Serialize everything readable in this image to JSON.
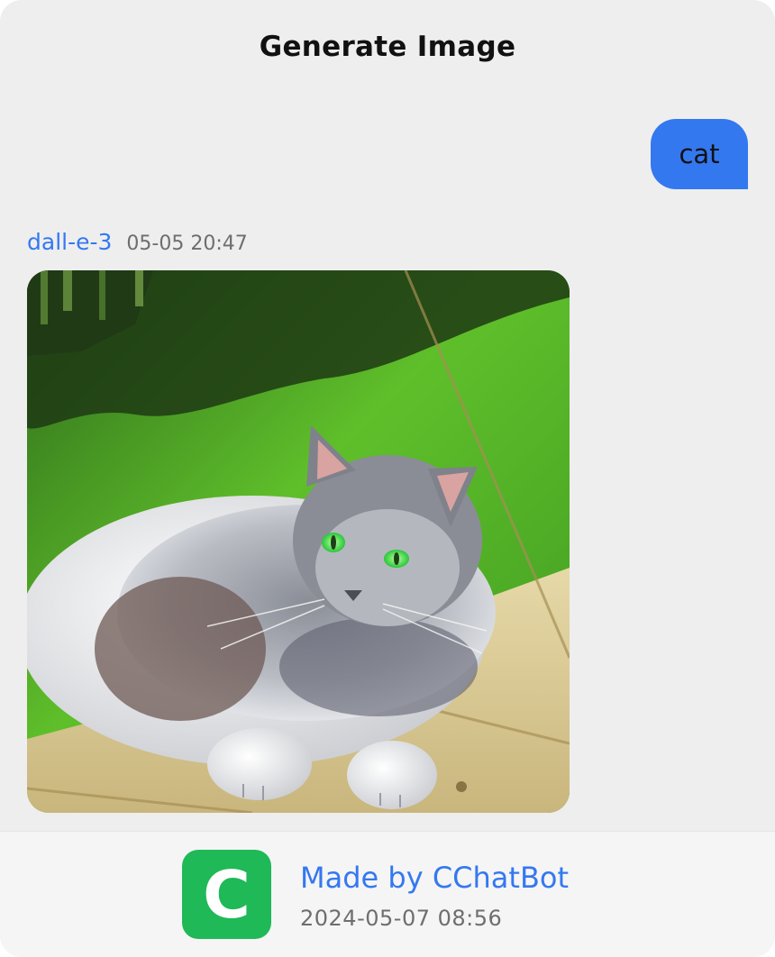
{
  "header": {
    "title": "Generate Image"
  },
  "conversation": {
    "user_message": {
      "text": "cat"
    },
    "bot_message": {
      "model": "dall-e-3",
      "timestamp": "05-05 20:47",
      "image": {
        "subject": "gray long-haired cat lying on a wooden deck with grass behind"
      }
    }
  },
  "footer": {
    "app_icon_letter": "C",
    "made_by": "Made by CChatBot",
    "date": "2024-05-07 08:56"
  },
  "colors": {
    "accent": "#3478f0",
    "background": "#eeeeee",
    "app_icon": "#1fb957"
  }
}
